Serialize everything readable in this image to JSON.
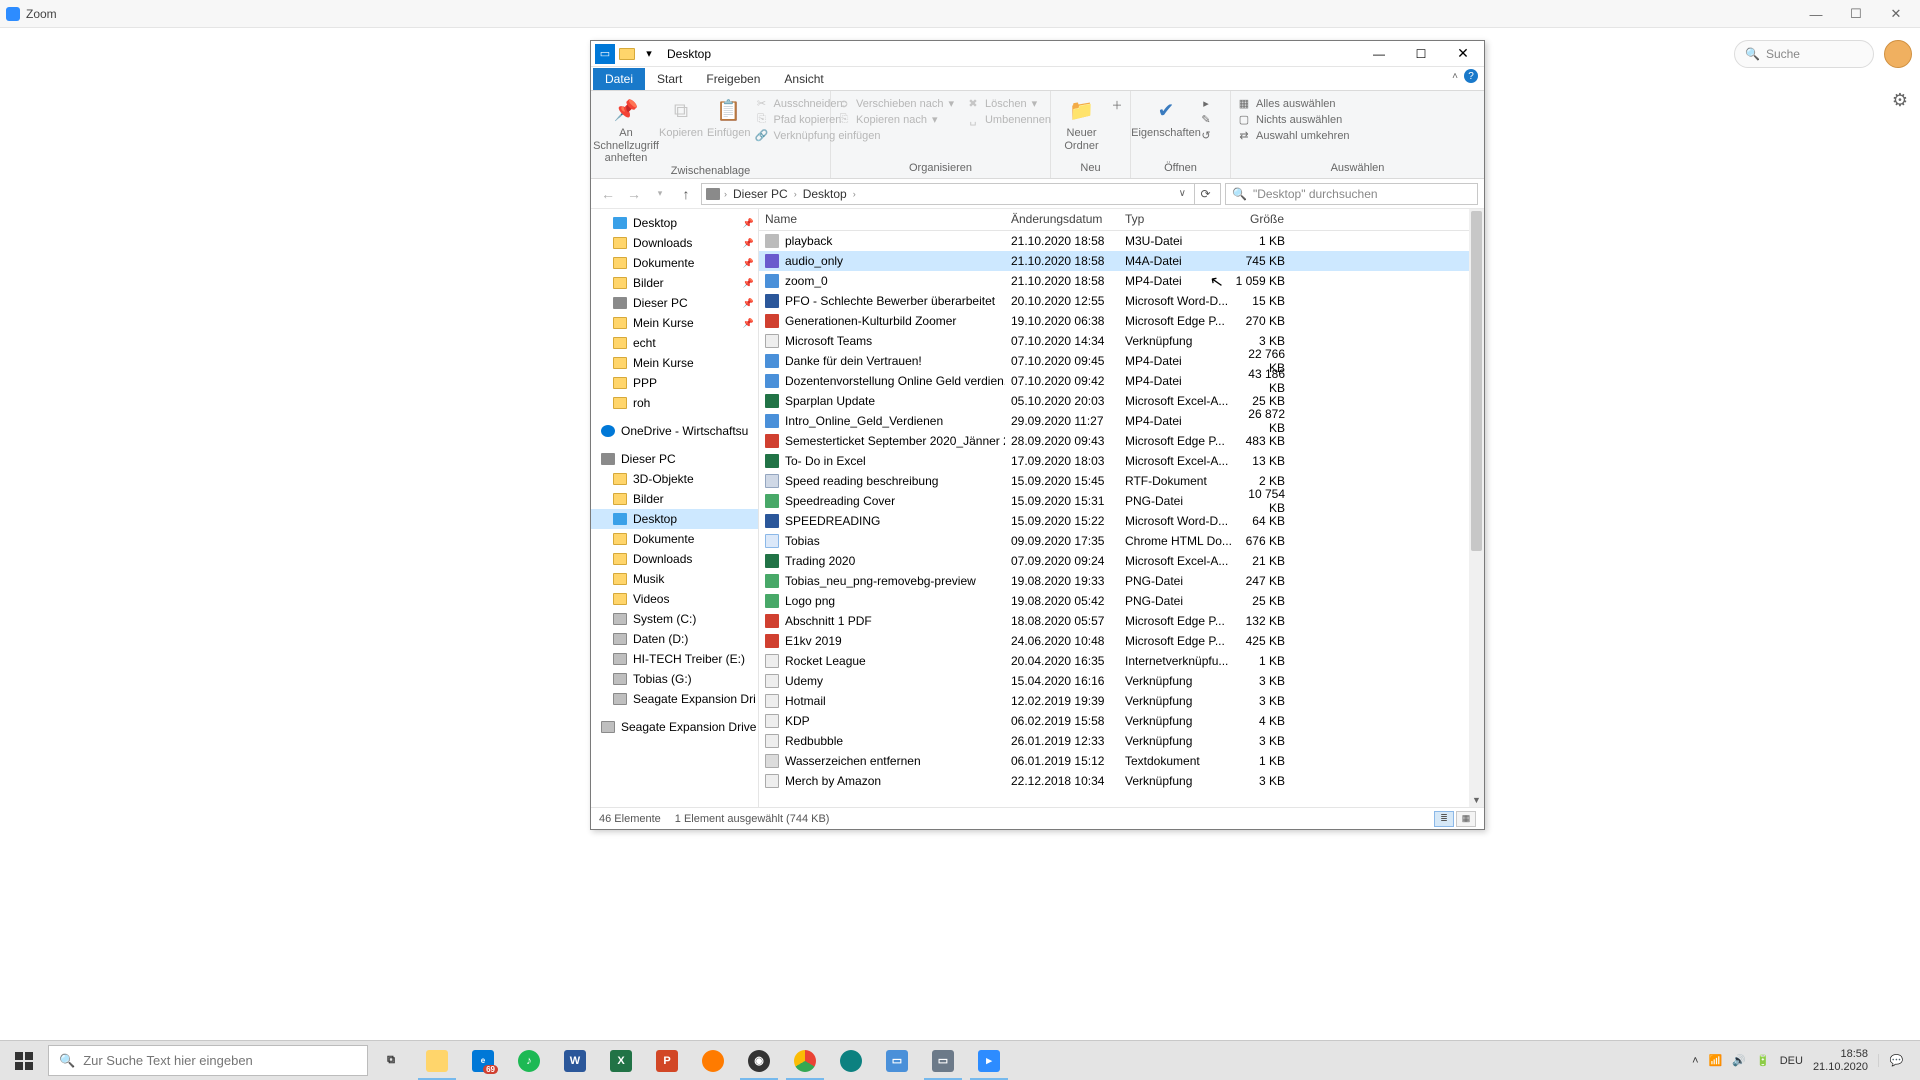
{
  "zoom": {
    "title": "Zoom",
    "search": "Suche"
  },
  "win_controls": {
    "min": "—",
    "max": "☐",
    "close": "✕"
  },
  "explorer": {
    "title": "Desktop",
    "tabs": {
      "file": "Datei",
      "start": "Start",
      "share": "Freigeben",
      "view": "Ansicht"
    },
    "ribbon": {
      "clipboard": {
        "pin": "An Schnellzugriff anheften",
        "copy": "Kopieren",
        "paste": "Einfügen",
        "cut": "Ausschneiden",
        "copypath": "Pfad kopieren",
        "pastelink": "Verknüpfung einfügen",
        "label": "Zwischenablage"
      },
      "organize": {
        "moveto": "Verschieben nach",
        "copyto": "Kopieren nach",
        "delete": "Löschen",
        "rename": "Umbenennen",
        "label": "Organisieren"
      },
      "new": {
        "folder": "Neuer Ordner",
        "label": "Neu"
      },
      "open": {
        "props": "Eigenschaften",
        "label": "Öffnen"
      },
      "select": {
        "all": "Alles auswählen",
        "none": "Nichts auswählen",
        "invert": "Auswahl umkehren",
        "label": "Auswählen"
      }
    },
    "crumbs": {
      "pc": "Dieser PC",
      "desktop": "Desktop"
    },
    "search_placeholder": "\"Desktop\" durchsuchen",
    "columns": {
      "name": "Name",
      "date": "Änderungsdatum",
      "type": "Typ",
      "size": "Größe"
    },
    "status": {
      "count": "46 Elemente",
      "selected": "1 Element ausgewählt (744 KB)"
    }
  },
  "nav": {
    "quick": [
      {
        "label": "Desktop",
        "ico": "fi-desktop",
        "pin": true
      },
      {
        "label": "Downloads",
        "ico": "fi-folder",
        "pin": true
      },
      {
        "label": "Dokumente",
        "ico": "fi-folder",
        "pin": true
      },
      {
        "label": "Bilder",
        "ico": "fi-folder",
        "pin": true
      },
      {
        "label": "Dieser PC",
        "ico": "fi-pc",
        "pin": true
      },
      {
        "label": "Mein Kurse",
        "ico": "fi-folder",
        "pin": true
      },
      {
        "label": "echt",
        "ico": "fi-folder",
        "pin": false
      },
      {
        "label": "Mein Kurse",
        "ico": "fi-folder",
        "pin": false
      },
      {
        "label": "PPP",
        "ico": "fi-folder",
        "pin": false
      },
      {
        "label": "roh",
        "ico": "fi-folder",
        "pin": false
      }
    ],
    "onedrive": "OneDrive - Wirtschaftsu",
    "pc": "Dieser PC",
    "pc_children": [
      {
        "label": "3D-Objekte",
        "ico": "fi-folder"
      },
      {
        "label": "Bilder",
        "ico": "fi-folder"
      },
      {
        "label": "Desktop",
        "ico": "fi-desktop",
        "selected": true
      },
      {
        "label": "Dokumente",
        "ico": "fi-folder"
      },
      {
        "label": "Downloads",
        "ico": "fi-folder"
      },
      {
        "label": "Musik",
        "ico": "fi-folder"
      },
      {
        "label": "Videos",
        "ico": "fi-folder"
      },
      {
        "label": "System (C:)",
        "ico": "fi-drive"
      },
      {
        "label": "Daten (D:)",
        "ico": "fi-drive"
      },
      {
        "label": "HI-TECH Treiber (E:)",
        "ico": "fi-drive"
      },
      {
        "label": "Tobias (G:)",
        "ico": "fi-drive"
      },
      {
        "label": "Seagate Expansion Dri",
        "ico": "fi-drive"
      }
    ],
    "seagate": "Seagate Expansion Drive"
  },
  "files": [
    {
      "name": "playback",
      "date": "21.10.2020 18:58",
      "type": "M3U-Datei",
      "size": "1 KB",
      "ico": "generic"
    },
    {
      "name": "audio_only",
      "date": "21.10.2020 18:58",
      "type": "M4A-Datei",
      "size": "745 KB",
      "ico": "audio",
      "selected": true
    },
    {
      "name": "zoom_0",
      "date": "21.10.2020 18:58",
      "type": "MP4-Datei",
      "size": "1 059 KB",
      "ico": "video"
    },
    {
      "name": "PFO - Schlechte Bewerber überarbeitet",
      "date": "20.10.2020 12:55",
      "type": "Microsoft Word-D...",
      "size": "15 KB",
      "ico": "word"
    },
    {
      "name": "Generationen-Kulturbild Zoomer",
      "date": "19.10.2020 06:38",
      "type": "Microsoft Edge P...",
      "size": "270 KB",
      "ico": "pdf"
    },
    {
      "name": "Microsoft Teams",
      "date": "07.10.2020 14:34",
      "type": "Verknüpfung",
      "size": "3 KB",
      "ico": "link"
    },
    {
      "name": "Danke für dein Vertrauen!",
      "date": "07.10.2020 09:45",
      "type": "MP4-Datei",
      "size": "22 766 KB",
      "ico": "video"
    },
    {
      "name": "Dozentenvorstellung Online Geld verdien...",
      "date": "07.10.2020 09:42",
      "type": "MP4-Datei",
      "size": "43 186 KB",
      "ico": "video"
    },
    {
      "name": "Sparplan Update",
      "date": "05.10.2020 20:03",
      "type": "Microsoft Excel-A...",
      "size": "25 KB",
      "ico": "excel"
    },
    {
      "name": "Intro_Online_Geld_Verdienen",
      "date": "29.09.2020 11:27",
      "type": "MP4-Datei",
      "size": "26 872 KB",
      "ico": "video"
    },
    {
      "name": "Semesterticket September 2020_Jänner 2...",
      "date": "28.09.2020 09:43",
      "type": "Microsoft Edge P...",
      "size": "483 KB",
      "ico": "pdf"
    },
    {
      "name": "To- Do in Excel",
      "date": "17.09.2020 18:03",
      "type": "Microsoft Excel-A...",
      "size": "13 KB",
      "ico": "excel"
    },
    {
      "name": "Speed reading beschreibung",
      "date": "15.09.2020 15:45",
      "type": "RTF-Dokument",
      "size": "2 KB",
      "ico": "rtf"
    },
    {
      "name": "Speedreading Cover",
      "date": "15.09.2020 15:31",
      "type": "PNG-Datei",
      "size": "10 754 KB",
      "ico": "png"
    },
    {
      "name": "SPEEDREADING",
      "date": "15.09.2020 15:22",
      "type": "Microsoft Word-D...",
      "size": "64 KB",
      "ico": "word"
    },
    {
      "name": "Tobias",
      "date": "09.09.2020 17:35",
      "type": "Chrome HTML Do...",
      "size": "676 KB",
      "ico": "html"
    },
    {
      "name": "Trading 2020",
      "date": "07.09.2020 09:24",
      "type": "Microsoft Excel-A...",
      "size": "21 KB",
      "ico": "excel"
    },
    {
      "name": "Tobias_neu_png-removebg-preview",
      "date": "19.08.2020 19:33",
      "type": "PNG-Datei",
      "size": "247 KB",
      "ico": "png"
    },
    {
      "name": "Logo png",
      "date": "19.08.2020 05:42",
      "type": "PNG-Datei",
      "size": "25 KB",
      "ico": "png"
    },
    {
      "name": "Abschnitt 1 PDF",
      "date": "18.08.2020 05:57",
      "type": "Microsoft Edge P...",
      "size": "132 KB",
      "ico": "pdf"
    },
    {
      "name": "E1kv 2019",
      "date": "24.06.2020 10:48",
      "type": "Microsoft Edge P...",
      "size": "425 KB",
      "ico": "pdf"
    },
    {
      "name": "Rocket League",
      "date": "20.04.2020 16:35",
      "type": "Internetverknüpfu...",
      "size": "1 KB",
      "ico": "link"
    },
    {
      "name": "Udemy",
      "date": "15.04.2020 16:16",
      "type": "Verknüpfung",
      "size": "3 KB",
      "ico": "link"
    },
    {
      "name": "Hotmail",
      "date": "12.02.2019 19:39",
      "type": "Verknüpfung",
      "size": "3 KB",
      "ico": "link"
    },
    {
      "name": "KDP",
      "date": "06.02.2019 15:58",
      "type": "Verknüpfung",
      "size": "4 KB",
      "ico": "link"
    },
    {
      "name": "Redbubble",
      "date": "26.01.2019 12:33",
      "type": "Verknüpfung",
      "size": "3 KB",
      "ico": "link"
    },
    {
      "name": "Wasserzeichen entfernen",
      "date": "06.01.2019 15:12",
      "type": "Textdokument",
      "size": "1 KB",
      "ico": "txt"
    },
    {
      "name": "Merch by Amazon",
      "date": "22.12.2018 10:34",
      "type": "Verknüpfung",
      "size": "3 KB",
      "ico": "link"
    }
  ],
  "taskbar": {
    "search": "Zur Suche Text hier eingeben",
    "tray": {
      "lang": "DEU",
      "time": "18:58",
      "date": "21.10.2020"
    },
    "edge_badge": "69"
  }
}
